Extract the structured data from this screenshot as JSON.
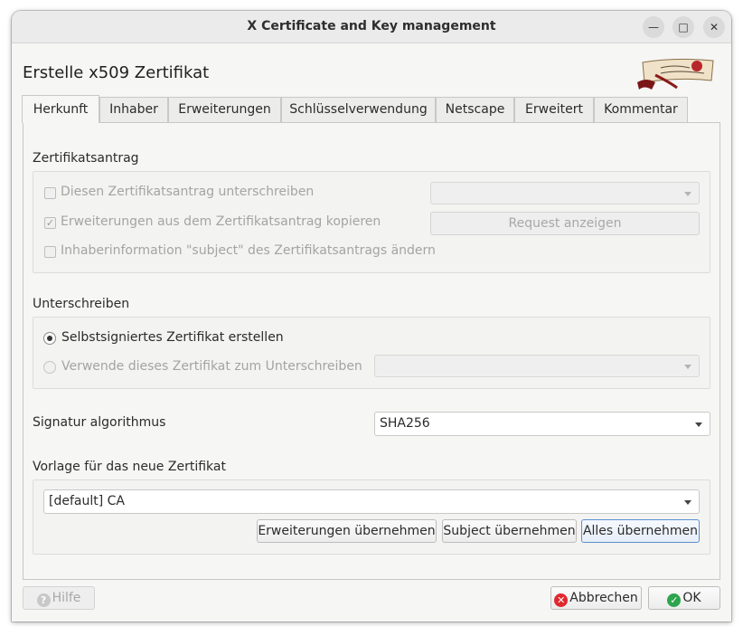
{
  "window": {
    "title": "X Certificate and Key management"
  },
  "header": {
    "title": "Erstelle x509 Zertifikat"
  },
  "tabs": [
    {
      "label": "Herkunft"
    },
    {
      "label": "Inhaber"
    },
    {
      "label": "Erweiterungen"
    },
    {
      "label": "Schlüsselverwendung"
    },
    {
      "label": "Netscape"
    },
    {
      "label": "Erweitert"
    },
    {
      "label": "Kommentar"
    }
  ],
  "request": {
    "heading": "Zertifikatsantrag",
    "sign_label": "Diesen Zertifikatsantrag unterschreiben",
    "copy_ext_label": "Erweiterungen aus dem Zertifikatsantrag kopieren",
    "copy_ext_checked": true,
    "modify_subject_label": "Inhaberinformation \"subject\" des Zertifikatsantrags ändern",
    "request_combo_value": "",
    "show_request_button": "Request anzeigen"
  },
  "signing": {
    "heading": "Unterschreiben",
    "self_signed_label": "Selbstsigniertes Zertifikat erstellen",
    "use_cert_label": "Verwende dieses Zertifikat zum Unterschreiben",
    "signer_combo_value": ""
  },
  "algorithm": {
    "label": "Signatur algorithmus",
    "value": "SHA256"
  },
  "template": {
    "heading": "Vorlage für das neue Zertifikat",
    "value": "[default] CA",
    "apply_extensions_button": "Erweiterungen übernehmen",
    "apply_subject_button": "Subject übernehmen",
    "apply_all_button": "Alles übernehmen"
  },
  "footer": {
    "help_button": "Hilfe",
    "cancel_button": "Abbrechen",
    "ok_button": "OK"
  },
  "colors": {
    "cancel_icon": "#e0282f",
    "ok_icon": "#2da44e",
    "focus_border": "#5b8fd0"
  }
}
